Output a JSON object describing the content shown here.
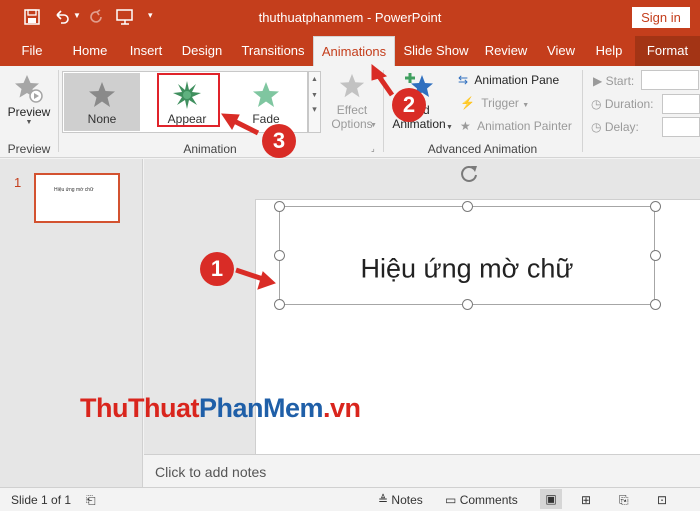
{
  "title_bar": {
    "title": "thuthuatphanmem  -  PowerPoint",
    "signin_label": "Sign in"
  },
  "tabs": [
    {
      "label": "File"
    },
    {
      "label": "Home"
    },
    {
      "label": "Insert"
    },
    {
      "label": "Design"
    },
    {
      "label": "Transitions"
    },
    {
      "label": "Animations",
      "active": true
    },
    {
      "label": "Slide Show"
    },
    {
      "label": "Review"
    },
    {
      "label": "View"
    },
    {
      "label": "Help"
    },
    {
      "label": "Format"
    }
  ],
  "ribbon": {
    "preview": {
      "button_label": "Preview",
      "group_label": "Preview"
    },
    "animation": {
      "group_label": "Animation",
      "gallery": [
        {
          "label": "None",
          "icon": "star-gray-icon",
          "selected": true
        },
        {
          "label": "Appear",
          "icon": "star-burst-green-icon",
          "highlighted": true
        },
        {
          "label": "Fade",
          "icon": "star-fade-green-icon"
        }
      ],
      "effect_options": {
        "line1": "Effect",
        "line2": "Options"
      }
    },
    "advanced": {
      "group_label": "Advanced Animation",
      "add_animation": {
        "line1": "Add",
        "line2": "Animation"
      },
      "animation_pane": "Animation Pane",
      "trigger": "Trigger",
      "animation_painter": "Animation Painter"
    },
    "timing": {
      "start_label": "Start:",
      "duration_label": "Duration:",
      "delay_label": "Delay:"
    }
  },
  "slides_pane": {
    "items": [
      {
        "number": "1",
        "thumb_text": "Hiệu ứng mờ chữ"
      }
    ]
  },
  "slide": {
    "textbox_text": "Hiệu ứng mờ chữ"
  },
  "notes": {
    "placeholder": "Click to add notes"
  },
  "status_bar": {
    "slide_info": "Slide 1 of 1",
    "notes_label": "Notes",
    "comments_label": "Comments"
  },
  "watermark": {
    "part1": "ThuThuat",
    "part2": "PhanMem",
    "part3": ".vn"
  },
  "callouts": [
    "1",
    "2",
    "3"
  ],
  "colors": {
    "accent": "#c43e1c",
    "callout": "#d92c26",
    "highlight_box": "#e0232a"
  }
}
